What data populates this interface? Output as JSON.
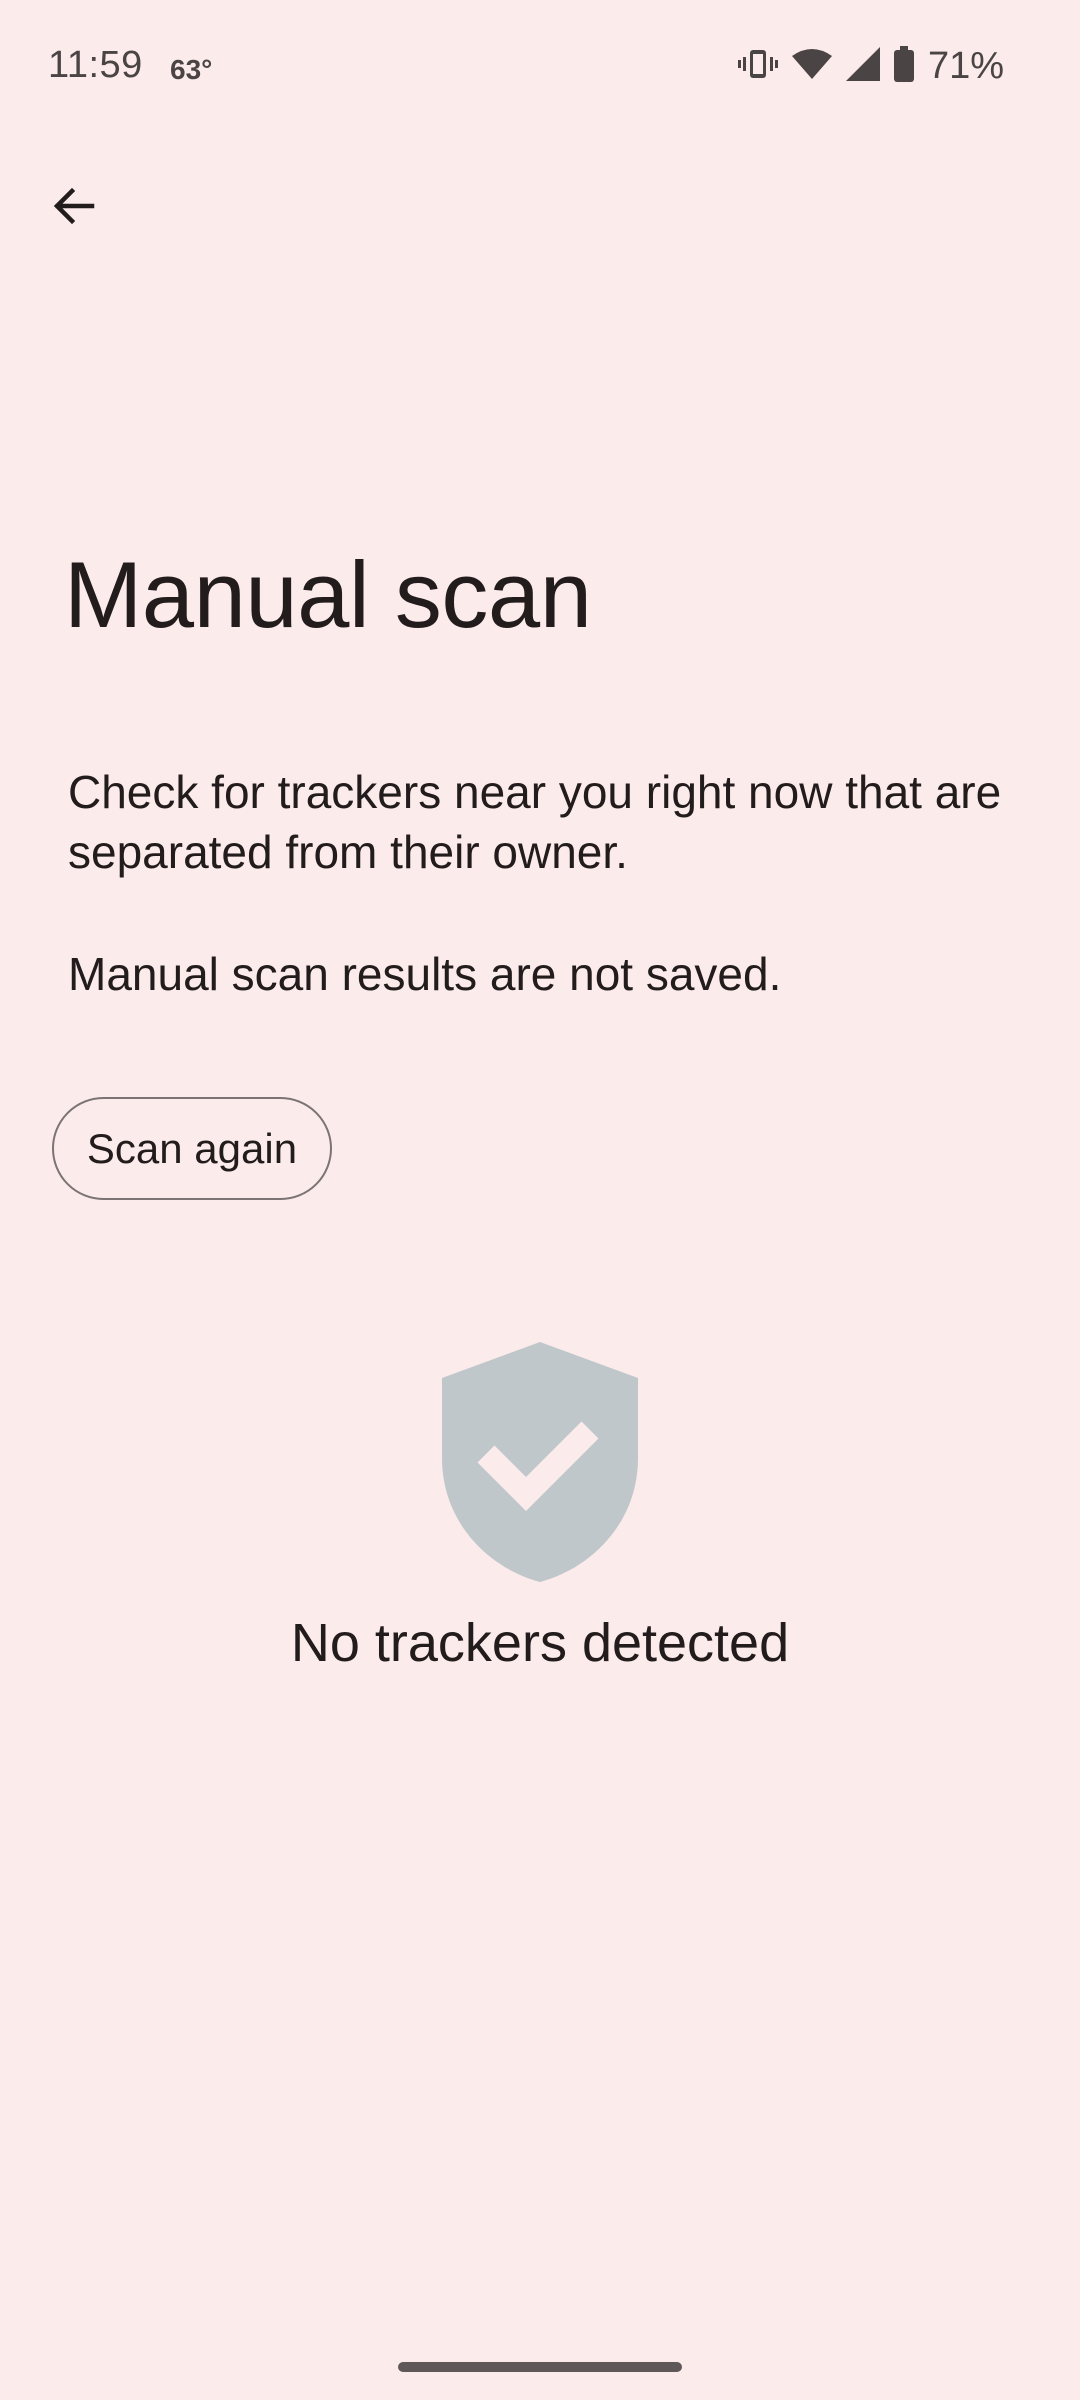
{
  "status_bar": {
    "time": "11:59",
    "temperature": "63°",
    "battery_percent": "71%",
    "icons": [
      "vibrate-icon",
      "wifi-icon",
      "cell-signal-icon",
      "battery-icon"
    ]
  },
  "nav": {
    "back_icon": "arrow-back-icon"
  },
  "main": {
    "title": "Manual scan",
    "description": "Check for trackers near you right now that are separated from their owner.",
    "note": "Manual scan results are not saved.",
    "scan_again_label": "Scan again",
    "result_icon": "shield-check-icon",
    "result_text": "No trackers detected"
  },
  "colors": {
    "background": "#FCEBEB",
    "shield": "#BFC7CA",
    "text": "#231C1C"
  }
}
